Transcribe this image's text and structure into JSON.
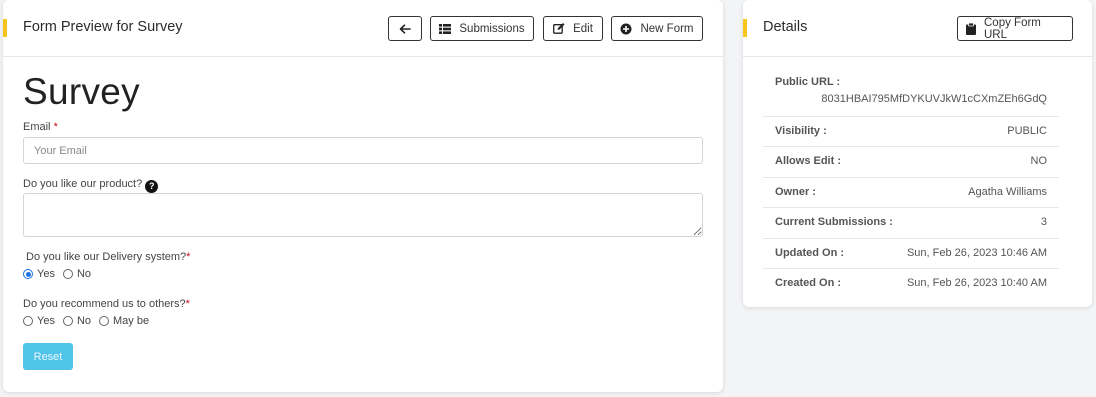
{
  "form_card": {
    "title": "Form Preview for Survey",
    "buttons": {
      "submissions": "Submissions",
      "edit": "Edit",
      "new_form": "New Form"
    },
    "form_heading": "Survey",
    "fields": {
      "email": {
        "label": "Email",
        "required_mark": "*",
        "placeholder": "Your Email"
      },
      "product": {
        "label": "Do you like our product?",
        "help_icon": "?"
      },
      "delivery": {
        "label": "Do you like our Delivery system?",
        "required_mark": "*",
        "options": [
          "Yes",
          "No"
        ],
        "selected": "Yes"
      },
      "recommend": {
        "label": "Do you recommend us to others?",
        "required_mark": "*",
        "options": [
          "Yes",
          "No",
          "May be"
        ],
        "selected": null
      }
    },
    "reset_label": "Reset"
  },
  "details_card": {
    "title": "Details",
    "copy_button": "Copy Form URL",
    "public_url_label": "Public URL :",
    "public_url_value": "8031HBAI795MfDYKUVJkW1cCXmZEh6GdQ",
    "rows": [
      {
        "key": "Visibility :",
        "value": "PUBLIC"
      },
      {
        "key": "Allows Edit :",
        "value": "NO"
      },
      {
        "key": "Owner :",
        "value": "Agatha Williams"
      },
      {
        "key": "Current Submissions :",
        "value": "3"
      },
      {
        "key": "Updated On :",
        "value": "Sun, Feb 26, 2023 10:46 AM"
      },
      {
        "key": "Created On :",
        "value": "Sun, Feb 26, 2023 10:40 AM"
      }
    ]
  },
  "colors": {
    "accent": "#f7c51c",
    "reset_button": "#4fc3e8",
    "required": "#c0101a"
  },
  "icons": [
    "arrow-left-icon",
    "list-icon",
    "edit-icon",
    "plus-circle-icon",
    "clipboard-icon",
    "help-icon"
  ]
}
